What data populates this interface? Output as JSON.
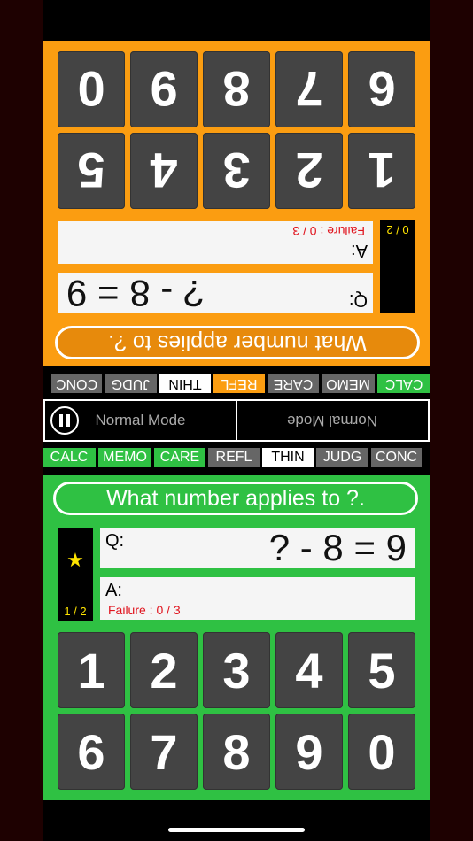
{
  "question": {
    "prompt": "What number applies to ?.",
    "q_label": "Q:",
    "expression": "? - 8 = 9",
    "a_label": "A:",
    "failure": "Failure : 0 / 3"
  },
  "player_bottom": {
    "score": "1 / 2",
    "star": "★"
  },
  "player_top": {
    "score": "0 / 2"
  },
  "keypad": {
    "row1": [
      "1",
      "2",
      "3",
      "4",
      "5"
    ],
    "row2": [
      "6",
      "7",
      "8",
      "9",
      "0"
    ]
  },
  "modes": {
    "calc": "CALC",
    "memo": "MEMO",
    "care": "CARE",
    "refl": "REFL",
    "thin": "THIN",
    "judg": "JUDG",
    "conc": "CONC"
  },
  "mode_bar": {
    "label": "Normal Mode"
  },
  "colors": {
    "player_bottom": "#2fc143",
    "player_top": "#fb9d11",
    "failure_text": "#e0141e",
    "score_text": "#ffe400"
  }
}
